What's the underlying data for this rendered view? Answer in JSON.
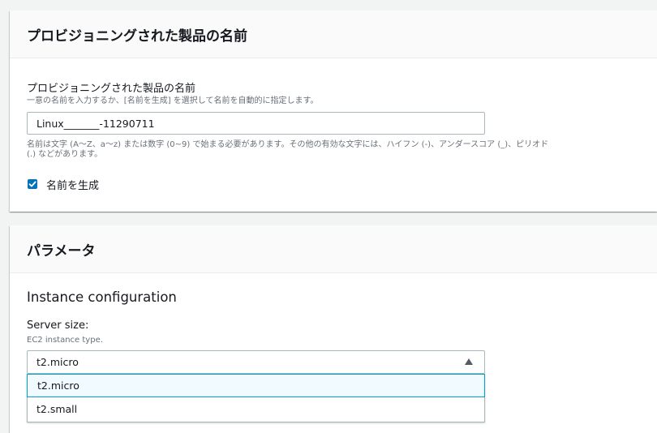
{
  "product_name_section": {
    "title": "プロビジョニングされた製品の名前",
    "field_label": "プロビジョニングされた製品の名前",
    "field_description": "一意の名前を入力するか、[名前を生成] を選択して名前を自動的に指定します。",
    "field_value": "Linux_______-11290711",
    "constraint_line1": "名前は文字 (A〜Z、a〜z) または数字 (0~9) で始まる必要があります。その他の有効な文字には、ハイフン (-)、アンダースコア (_)、ピリオド",
    "constraint_line2": "(.) などがあります。",
    "generate_name_label": "名前を生成",
    "generate_name_checked": true
  },
  "parameters_section": {
    "title": "パラメータ",
    "subheading": "Instance configuration",
    "server_size_label": "Server size:",
    "server_size_description": "EC2 instance type.",
    "server_size_value": "t2.micro",
    "options": [
      "t2.micro",
      "t2.small"
    ]
  },
  "colors": {
    "accent": "#0073bb",
    "focus_border": "#00a1c9",
    "selected_bg": "#f1faff"
  }
}
